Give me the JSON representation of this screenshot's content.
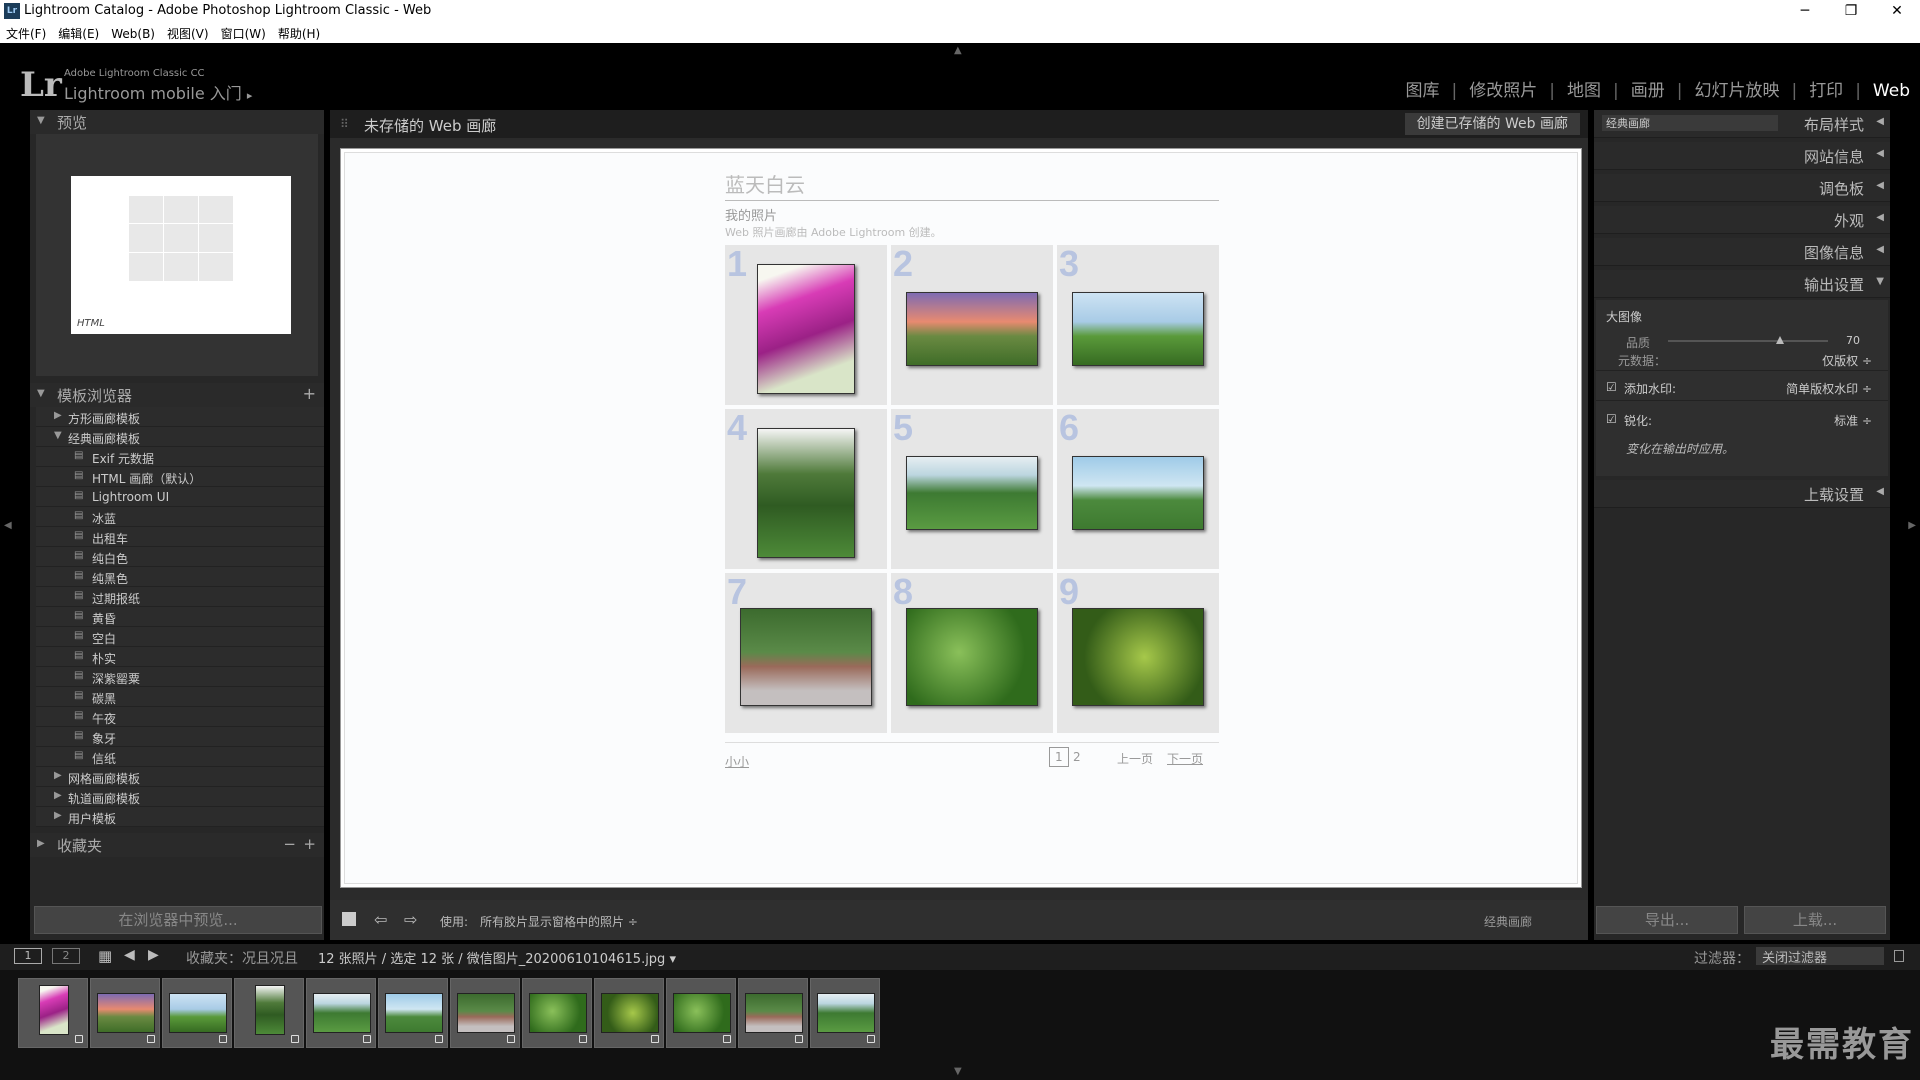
{
  "window": {
    "title": "Lightroom Catalog - Adobe Photoshop Lightroom Classic - Web",
    "app_badge": "Lr",
    "min": "─",
    "max": "❐",
    "close": "✕"
  },
  "menu": [
    "文件(F)",
    "编辑(E)",
    "Web(B)",
    "视图(V)",
    "窗口(W)",
    "帮助(H)"
  ],
  "identity": {
    "logo": "Lr",
    "line1": "Adobe Lightroom Classic CC",
    "line2": "Lightroom mobile 入门",
    "arrow": "▸"
  },
  "modules": [
    {
      "label": "图库",
      "active": false
    },
    {
      "label": "修改照片",
      "active": false
    },
    {
      "label": "地图",
      "active": false
    },
    {
      "label": "画册",
      "active": false
    },
    {
      "label": "幻灯片放映",
      "active": false
    },
    {
      "label": "打印",
      "active": false
    },
    {
      "label": "Web",
      "active": true
    }
  ],
  "left": {
    "preview_header": "预览",
    "preview_label": "HTML",
    "template_header": "模板浏览器",
    "template_add": "+",
    "templates": [
      {
        "label": "方形画廊模板",
        "type": "folder",
        "expanded": false
      },
      {
        "label": "经典画廊模板",
        "type": "folder",
        "expanded": true
      },
      {
        "label": "Exif 元数据",
        "type": "item"
      },
      {
        "label": "HTML 画廊（默认）",
        "type": "item"
      },
      {
        "label": "Lightroom UI",
        "type": "item"
      },
      {
        "label": "冰蓝",
        "type": "item"
      },
      {
        "label": "出租车",
        "type": "item"
      },
      {
        "label": "纯白色",
        "type": "item"
      },
      {
        "label": "纯黑色",
        "type": "item"
      },
      {
        "label": "过期报纸",
        "type": "item"
      },
      {
        "label": "黄昏",
        "type": "item"
      },
      {
        "label": "空白",
        "type": "item"
      },
      {
        "label": "朴实",
        "type": "item"
      },
      {
        "label": "深紫罂粟",
        "type": "item"
      },
      {
        "label": "碳黑",
        "type": "item"
      },
      {
        "label": "午夜",
        "type": "item"
      },
      {
        "label": "象牙",
        "type": "item"
      },
      {
        "label": "信纸",
        "type": "item"
      },
      {
        "label": "网格画廊模板",
        "type": "folder",
        "expanded": false
      },
      {
        "label": "轨道画廊模板",
        "type": "folder",
        "expanded": false
      },
      {
        "label": "用户模板",
        "type": "folder",
        "expanded": false
      }
    ],
    "collections_header": "收藏夹",
    "collections_minus": "−",
    "collections_plus": "+",
    "preview_button": "在浏览器中预览..."
  },
  "center": {
    "header_title": "未存储的 Web 画廊",
    "save_button": "创建已存储的 Web 画廊",
    "site_title": "蓝天白云",
    "collection_title": "我的照片",
    "collection_desc": "Web 照片画廊由 Adobe Lightroom 创建。",
    "cells": [
      "1",
      "2",
      "3",
      "4",
      "5",
      "6",
      "7",
      "8",
      "9"
    ],
    "pager": {
      "left": "小小",
      "page1": "1",
      "page2": "2",
      "prev": "上一页",
      "next": "下一页"
    },
    "toolbar": {
      "use_label": "使用:",
      "use_value": "所有胶片显示窗格中的照片 ÷",
      "right_label": "经典画廊"
    }
  },
  "right": {
    "headers": [
      "布局样式",
      "网站信息",
      "调色板",
      "外观",
      "图像信息",
      "输出设置",
      "上载设置"
    ],
    "layout_select": "经典画廊",
    "output": {
      "section": "大图像",
      "quality_label": "品质",
      "quality_value": "70",
      "quality_fraction": 0.7,
      "metadata_label": "元数据：",
      "metadata_value": "仅版权 ÷",
      "watermark_label": "添加水印:",
      "watermark_value": "简单版权水印 ÷",
      "sharpen_label": "锐化:",
      "sharpen_value": "标准 ÷",
      "note": "变化在输出时应用。"
    },
    "export_button": "导出...",
    "upload_button": "上载..."
  },
  "filmstrip": {
    "view1": "1",
    "view2": "2",
    "source": "收藏夹：况且况且",
    "count": "12 张照片 / 选定 12 张 / 微信图片_20200610104615.jpg ▾",
    "filter_label": "过滤器：",
    "filter_value": "关闭过滤器"
  },
  "watermark": "最需教育"
}
